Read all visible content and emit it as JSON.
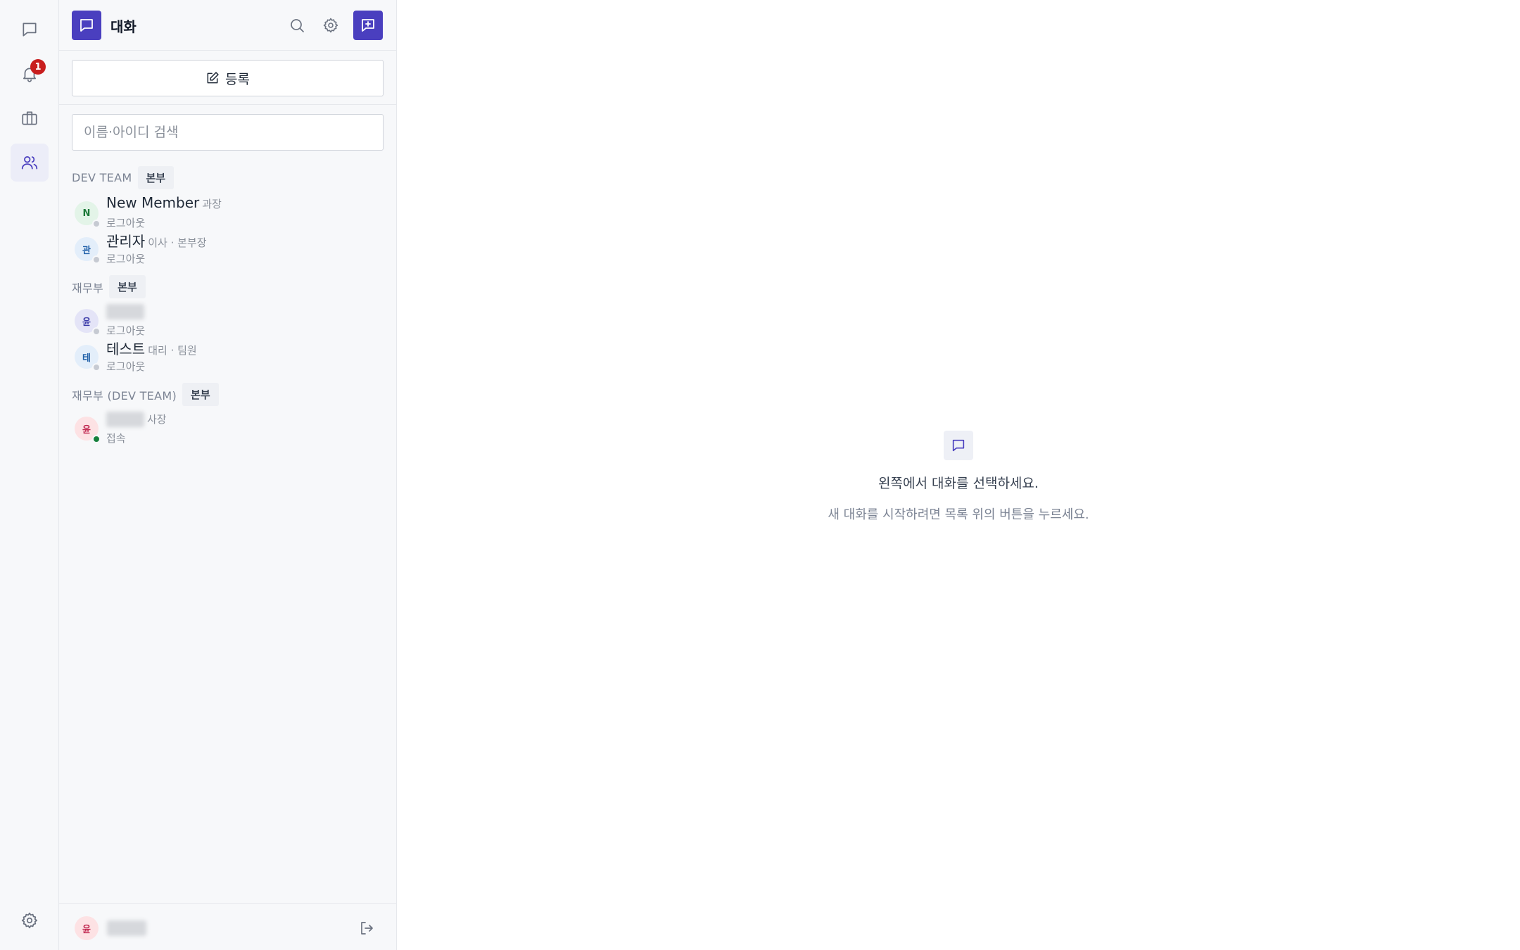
{
  "rail": {
    "items": [
      {
        "icon": "chat-bubble-icon",
        "active": false
      },
      {
        "icon": "bell-icon",
        "active": false,
        "badge": "1"
      },
      {
        "icon": "briefcase-icon",
        "active": false
      },
      {
        "icon": "users-icon",
        "active": true
      }
    ],
    "settings_icon": "gear-icon"
  },
  "panel": {
    "title": "대화",
    "register_label": "등록",
    "search_placeholder": "이름·아이디 검색",
    "groups": [
      {
        "name": "DEV TEAM",
        "tag": "본부",
        "members": [
          {
            "initial": "N",
            "name": "New Member",
            "meta": "과장",
            "status": "로그아웃",
            "online": false,
            "avatar_bg": "#e3f4e8",
            "avatar_fg": "#1d7a3a"
          },
          {
            "initial": "관",
            "name": "관리자",
            "meta": "이사 · 본부장",
            "status": "로그아웃",
            "online": false,
            "avatar_bg": "#e3eefa",
            "avatar_fg": "#1f5fa8"
          }
        ]
      },
      {
        "name": "재무부",
        "tag": "본부",
        "members": [
          {
            "initial": "윤",
            "name": "",
            "meta": "",
            "status": "로그아웃",
            "online": false,
            "avatar_bg": "#e4e4f7",
            "avatar_fg": "#3b3aa8",
            "redacted": true
          },
          {
            "initial": "테",
            "name": "테스트",
            "meta": "대리 · 팀원",
            "status": "로그아웃",
            "online": false,
            "avatar_bg": "#e3eefa",
            "avatar_fg": "#1f5fa8"
          }
        ]
      },
      {
        "name": "재무부 (DEV TEAM)",
        "tag": "본부",
        "members": [
          {
            "initial": "윤",
            "name": "",
            "meta": "사장",
            "status": "접속",
            "online": true,
            "avatar_bg": "#fde2e4",
            "avatar_fg": "#c0264f",
            "redacted": true
          }
        ]
      }
    ],
    "footer": {
      "initial": "윤"
    }
  },
  "main": {
    "empty_title": "왼쪽에서 대화를 선택하세요.",
    "empty_subtitle": "새 대화를 시작하려면 목록 위의 버튼을 누르세요."
  },
  "colors": {
    "accent": "#4a3fbf",
    "badge": "#c81e1e",
    "online": "#16803c"
  }
}
